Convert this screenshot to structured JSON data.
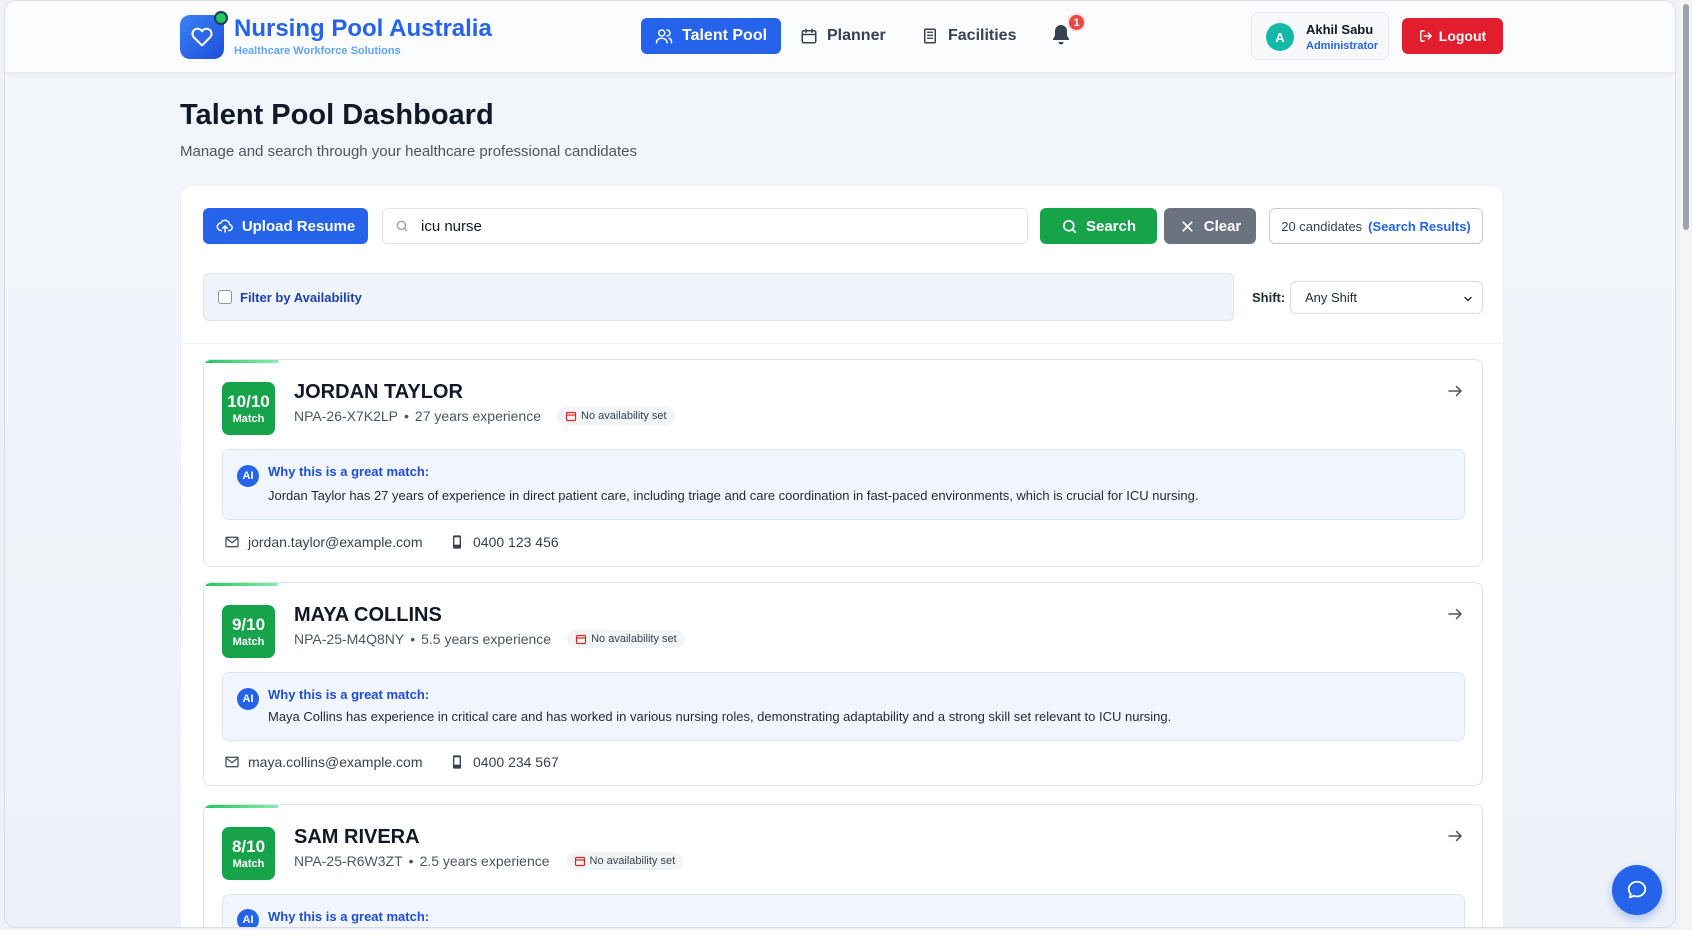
{
  "brand": {
    "title": "Nursing Pool Australia",
    "subtitle": "Healthcare Workforce Solutions",
    "icon": "heart-icon"
  },
  "nav": {
    "items": [
      {
        "label": "Talent Pool",
        "icon": "users-icon",
        "active": true
      },
      {
        "label": "Planner",
        "icon": "calendar-icon",
        "active": false
      },
      {
        "label": "Facilities",
        "icon": "building-icon",
        "active": false
      }
    ],
    "notifications": "1"
  },
  "user": {
    "initial": "A",
    "name": "Akhil Sabu",
    "role": "Administrator"
  },
  "logout_label": "Logout",
  "page": {
    "title": "Talent Pool Dashboard",
    "subtitle": "Manage and search through your healthcare professional candidates"
  },
  "toolbar": {
    "upload_label": "Upload Resume",
    "search_value": "icu nurse",
    "search_label": "Search",
    "clear_label": "Clear",
    "count": "20 candidates",
    "count_note": "(Search Results)"
  },
  "filters": {
    "availability_label": "Filter by Availability",
    "availability_checked": false,
    "shift_label": "Shift:",
    "shift_value": "Any Shift"
  },
  "candidates": [
    {
      "score": "10/10",
      "match": "Match",
      "name": "JORDAN TAYLOR",
      "id": "NPA-26-X7K2LP",
      "experience": "27 years experience",
      "availability": "No availability set",
      "ai_title": "Why this is a great match:",
      "ai_text": "Jordan Taylor has 27 years of experience in direct patient care, including triage and care coordination in fast-paced environments, which is crucial for ICU nursing.",
      "email": "jordan.taylor@example.com",
      "phone": "0400 123 456"
    },
    {
      "score": "9/10",
      "match": "Match",
      "name": "MAYA COLLINS",
      "id": "NPA-25-M4Q8NY",
      "experience": "5.5 years experience",
      "availability": "No availability set",
      "ai_title": "Why this is a great match:",
      "ai_text": "Maya Collins has experience in critical care and has worked in various nursing roles, demonstrating adaptability and a strong skill set relevant to ICU nursing.",
      "email": "maya.collins@example.com",
      "phone": "0400 234 567"
    },
    {
      "score": "8/10",
      "match": "Match",
      "name": "SAM RIVERA",
      "id": "NPA-25-R6W3ZT",
      "experience": "2.5 years experience",
      "availability": "No availability set",
      "ai_title": "Why this is a great match:"
    }
  ],
  "colors": {
    "primary": "#2563eb",
    "success": "#16a34a",
    "danger": "#e11d2e",
    "neutral": "#6b7280"
  }
}
